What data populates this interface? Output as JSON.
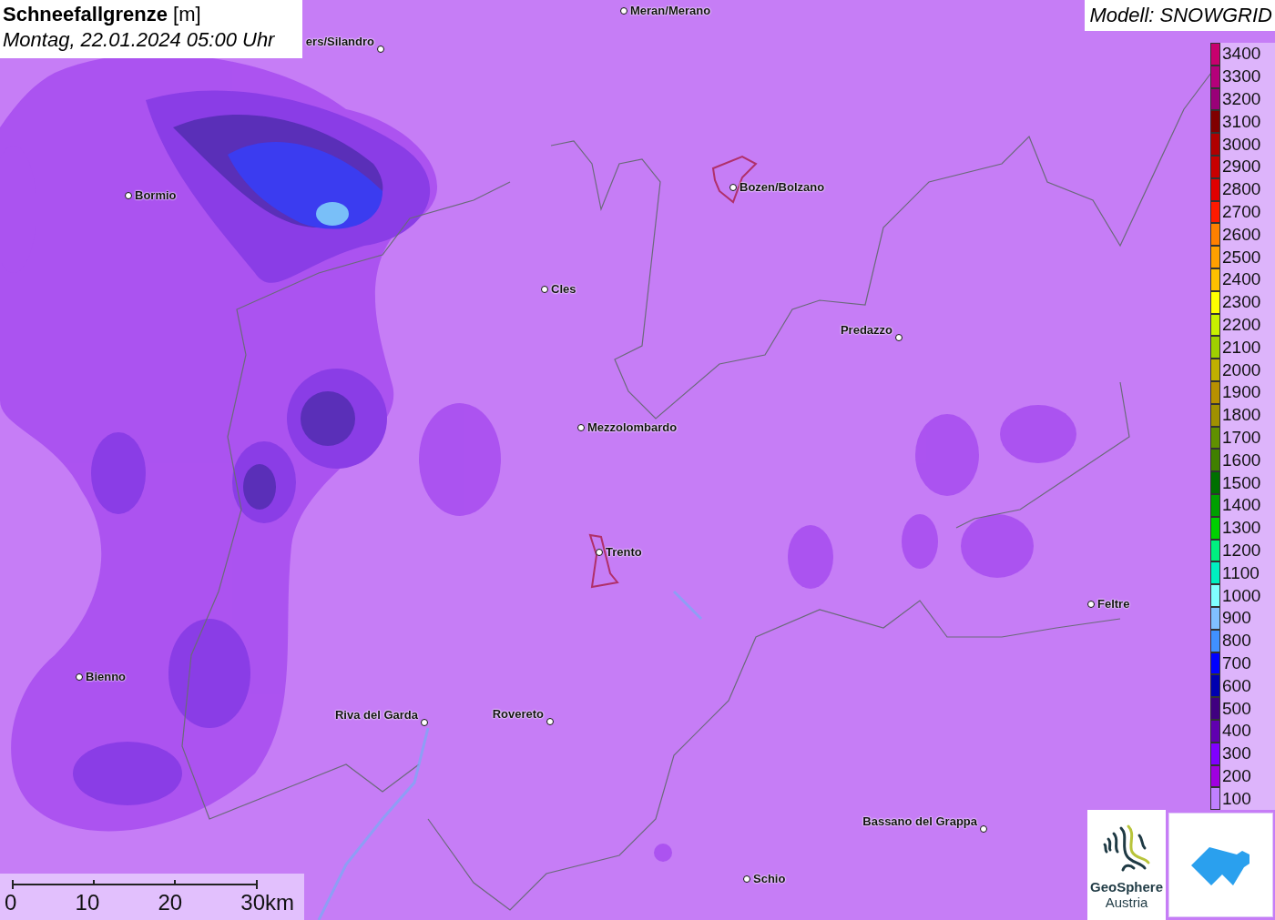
{
  "title": {
    "heading": "**Schneefallgrenze** [m]",
    "time": "Montag, 22.01.2024 05:00 Uhr"
  },
  "model": "Modell: SNOWGRID",
  "cities": [
    {
      "name": "Meran/Merano"
    },
    {
      "name": "ers/Silandro"
    },
    {
      "name": "Bozen/Bolzano"
    },
    {
      "name": "Bormio"
    },
    {
      "name": "Cles"
    },
    {
      "name": "Predazzo"
    },
    {
      "name": "Mezzolombardo"
    },
    {
      "name": "Trento"
    },
    {
      "name": "Feltre"
    },
    {
      "name": "Bienno"
    },
    {
      "name": "Riva del Garda"
    },
    {
      "name": "Rovereto"
    },
    {
      "name": "Bassano del Grappa"
    },
    {
      "name": "Schio"
    }
  ],
  "legend": [
    {
      "label": "3400",
      "color": "#c8006e"
    },
    {
      "label": "3300",
      "color": "#b4007a"
    },
    {
      "label": "3200",
      "color": "#9a0078"
    },
    {
      "label": "3100",
      "color": "#800000"
    },
    {
      "label": "3000",
      "color": "#b00000"
    },
    {
      "label": "2900",
      "color": "#c80000"
    },
    {
      "label": "2800",
      "color": "#e00000"
    },
    {
      "label": "2700",
      "color": "#ff1a00"
    },
    {
      "label": "2600",
      "color": "#ff8000"
    },
    {
      "label": "2500",
      "color": "#ffa000"
    },
    {
      "label": "2400",
      "color": "#ffc000"
    },
    {
      "label": "2300",
      "color": "#ffff00"
    },
    {
      "label": "2200",
      "color": "#c8f000"
    },
    {
      "label": "2100",
      "color": "#a0d000"
    },
    {
      "label": "2000",
      "color": "#c0b000"
    },
    {
      "label": "1900",
      "color": "#b89000"
    },
    {
      "label": "1800",
      "color": "#a09000"
    },
    {
      "label": "1700",
      "color": "#609000"
    },
    {
      "label": "1600",
      "color": "#408000"
    },
    {
      "label": "1500",
      "color": "#007000"
    },
    {
      "label": "1400",
      "color": "#00a000"
    },
    {
      "label": "1300",
      "color": "#00d000"
    },
    {
      "label": "1200",
      "color": "#00f080"
    },
    {
      "label": "1100",
      "color": "#00f0c0"
    },
    {
      "label": "1000",
      "color": "#80ffff"
    },
    {
      "label": "900",
      "color": "#80c0ff"
    },
    {
      "label": "800",
      "color": "#4090ff"
    },
    {
      "label": "700",
      "color": "#0000ff"
    },
    {
      "label": "600",
      "color": "#0000b0"
    },
    {
      "label": "500",
      "color": "#400080"
    },
    {
      "label": "400",
      "color": "#6000b0"
    },
    {
      "label": "300",
      "color": "#8000ff"
    },
    {
      "label": "200",
      "color": "#a000e0"
    },
    {
      "label": "100",
      "color": "#c080ff"
    }
  ],
  "scale": [
    "0",
    "10",
    "20",
    "30km"
  ],
  "logo": {
    "name": "GeoSphere",
    "sub": "Austria"
  }
}
